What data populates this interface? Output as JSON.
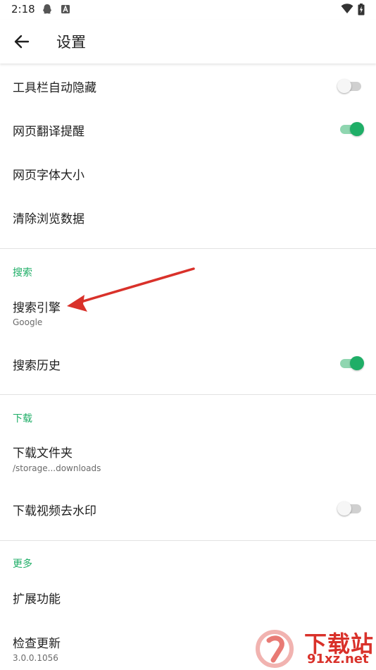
{
  "status_bar": {
    "time": "2:18"
  },
  "app_bar": {
    "title": "设置"
  },
  "general": [
    {
      "title": "工具栏自动隐藏",
      "toggle": "off"
    },
    {
      "title": "网页翻译提醒",
      "toggle": "on"
    },
    {
      "title": "网页字体大小"
    },
    {
      "title": "清除浏览数据"
    }
  ],
  "search": {
    "header": "搜索",
    "engine": {
      "title": "搜索引擎",
      "value": "Google"
    },
    "history": {
      "title": "搜索历史",
      "toggle": "on"
    }
  },
  "download": {
    "header": "下载",
    "folder": {
      "title": "下载文件夹",
      "value": "/storage...downloads"
    },
    "watermark": {
      "title": "下载视频去水印",
      "toggle": "off"
    }
  },
  "more": {
    "header": "更多",
    "extensions": {
      "title": "扩展功能"
    },
    "update": {
      "title": "检查更新",
      "value": "3.0.0.1056"
    }
  },
  "watermark_logo": {
    "text": "下载站",
    "domain": "91xz.net"
  },
  "colors": {
    "accent": "#1fae67",
    "arrow": "#d9312a"
  }
}
